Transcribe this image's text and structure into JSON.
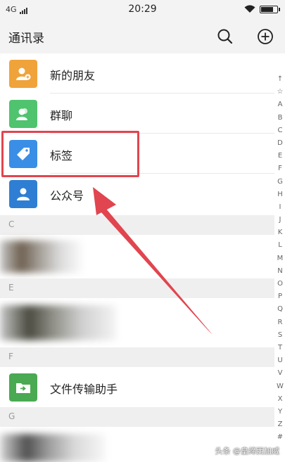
{
  "status_bar": {
    "network": "4G",
    "time": "20:29",
    "battery_fill": 0.85
  },
  "header": {
    "title": "通讯录",
    "icons": [
      "search-icon",
      "add-icon"
    ]
  },
  "menu_items": [
    {
      "label": "新的朋友",
      "icon": "add-friend-icon",
      "color": "#f0a33a"
    },
    {
      "label": "群聊",
      "icon": "group-chat-icon",
      "color": "#4fc36e"
    },
    {
      "label": "标签",
      "icon": "tag-icon",
      "color": "#3a8ee6"
    },
    {
      "label": "公众号",
      "icon": "official-account-icon",
      "color": "#2e7fd3"
    }
  ],
  "sections": [
    {
      "letter": "C"
    },
    {
      "letter": "E"
    },
    {
      "letter": "F"
    },
    {
      "letter": "G"
    }
  ],
  "contacts": [
    {
      "section": "F",
      "name": "文件传输助手",
      "icon": "file-transfer-icon",
      "color": "#4aa953"
    }
  ],
  "index_letters": [
    "↑",
    "☆",
    "A",
    "B",
    "C",
    "D",
    "E",
    "F",
    "G",
    "H",
    "I",
    "J",
    "K",
    "L",
    "M",
    "N",
    "O",
    "P",
    "Q",
    "R",
    "S",
    "T",
    "U",
    "V",
    "W",
    "X",
    "Y",
    "Z",
    "#"
  ],
  "annotation": {
    "highlight_color": "#e1454f"
  },
  "watermark": "头条 @皇缔西加威"
}
